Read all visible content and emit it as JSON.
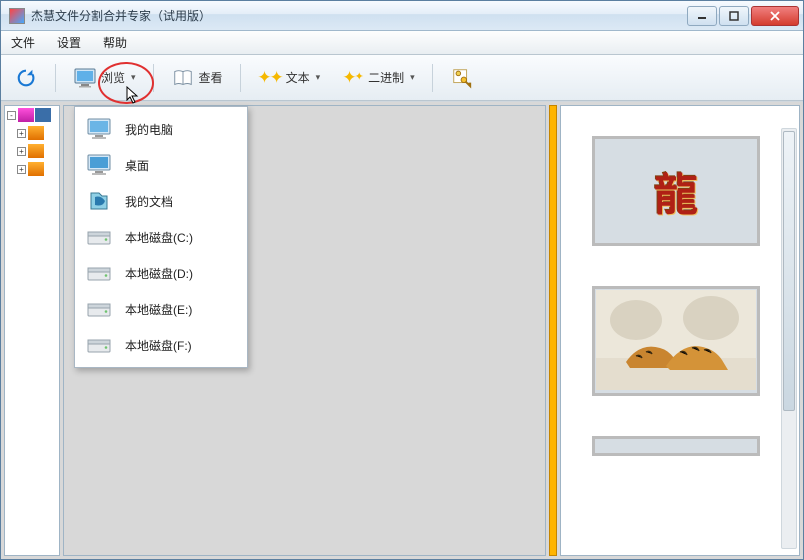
{
  "window": {
    "title": "杰慧文件分割合并专家（试用版）"
  },
  "menu": {
    "file": "文件",
    "settings": "设置",
    "help": "帮助"
  },
  "toolbar": {
    "browse": "浏览",
    "view": "查看",
    "text": "文本",
    "binary": "二进制"
  },
  "dropdown": {
    "items": [
      {
        "icon": "computer",
        "label": "我的电脑"
      },
      {
        "icon": "desktop",
        "label": "桌面"
      },
      {
        "icon": "mydocs",
        "label": "我的文档"
      },
      {
        "icon": "drive",
        "label": "本地磁盘(C:)"
      },
      {
        "icon": "drive",
        "label": "本地磁盘(D:)"
      },
      {
        "icon": "drive",
        "label": "本地磁盘(E:)"
      },
      {
        "icon": "drive",
        "label": "本地磁盘(F:)"
      }
    ]
  },
  "thumbs": [
    {
      "name": "dragon-thumb"
    },
    {
      "name": "tiger-thumb"
    }
  ]
}
